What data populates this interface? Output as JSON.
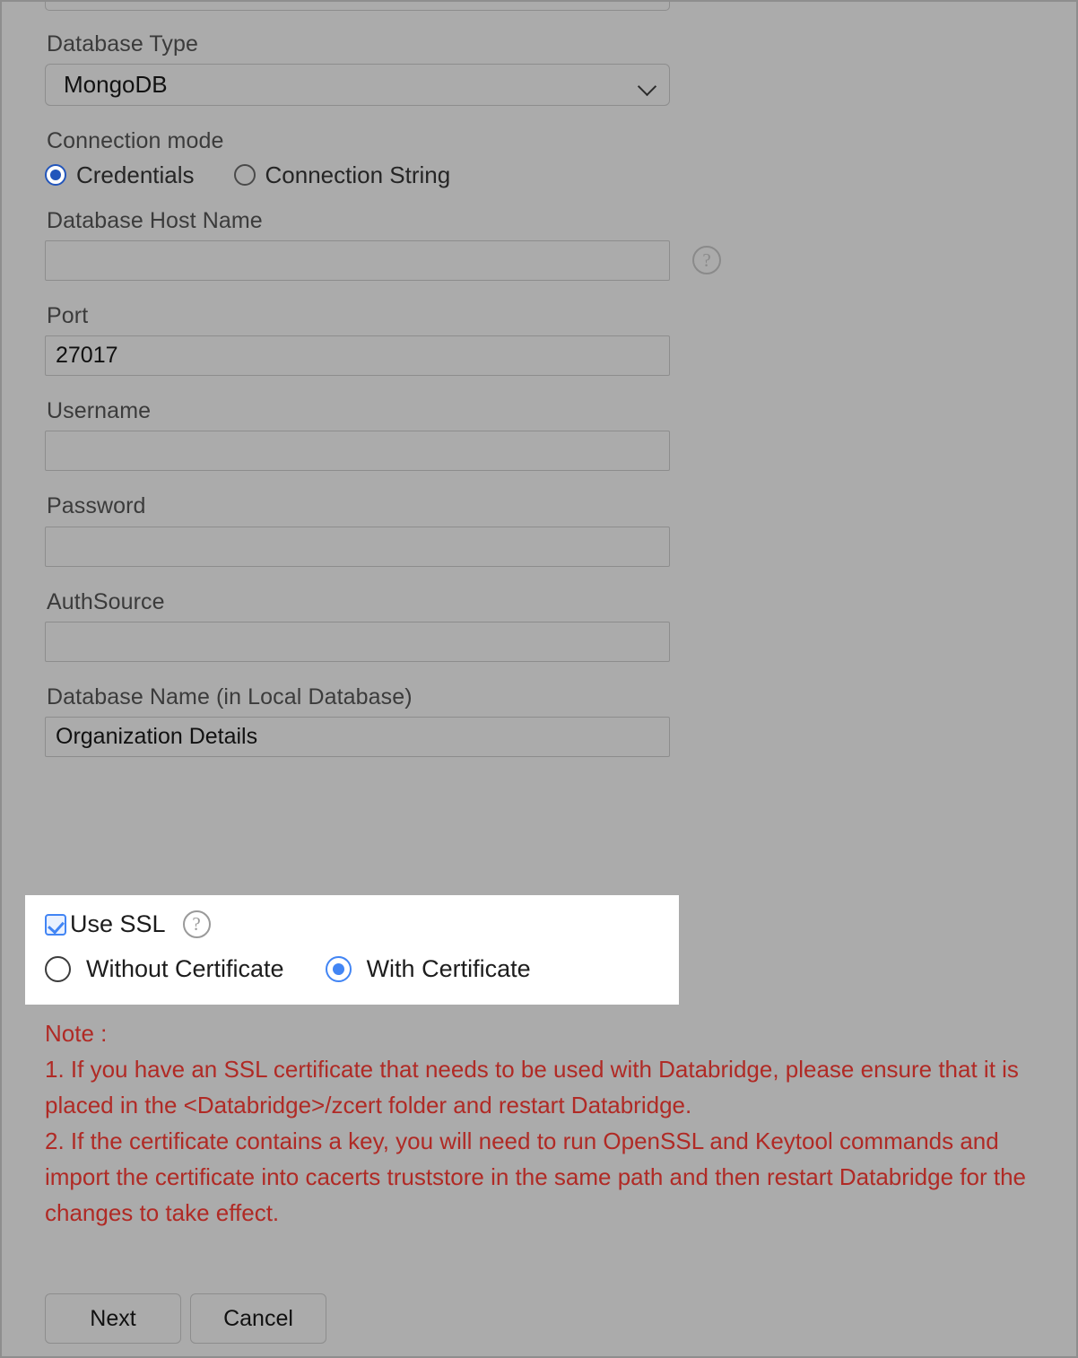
{
  "form": {
    "database_type": {
      "label": "Database Type",
      "value": "MongoDB",
      "chevron_icon": "chevron-down-icon"
    },
    "connection_mode": {
      "label": "Connection mode",
      "options": [
        {
          "label": "Credentials",
          "selected": true
        },
        {
          "label": "Connection String",
          "selected": false
        }
      ]
    },
    "database_host_name": {
      "label": "Database Host Name",
      "value": "",
      "placeholder": "",
      "help_icon": "help-icon"
    },
    "port": {
      "label": "Port",
      "value": "27017",
      "placeholder": ""
    },
    "username": {
      "label": "Username",
      "value": "",
      "placeholder": ""
    },
    "password": {
      "label": "Password",
      "value": "",
      "placeholder": ""
    },
    "authsource": {
      "label": "AuthSource",
      "value": "",
      "placeholder": ""
    },
    "database_name": {
      "label": "Database Name (in Local Database)",
      "value": "Organization Details",
      "placeholder": ""
    }
  },
  "ssl": {
    "checkbox_label": "Use SSL",
    "checked": true,
    "help_icon": "help-icon",
    "options": [
      {
        "label": "Without Certificate",
        "selected": false
      },
      {
        "label": "With Certificate",
        "selected": true
      }
    ]
  },
  "note": {
    "heading": "Note :",
    "item1": "1. If you have an SSL certificate that needs to be used with Databridge, please ensure that it is placed in the <Databridge>/zcert folder and restart Databridge.",
    "item2": "2. If the certificate contains a key, you will need to run OpenSSL and Keytool commands and import the certificate into cacerts truststore in the same path and then restart Databridge for the changes to take effect."
  },
  "buttons": {
    "next": "Next",
    "cancel": "Cancel"
  },
  "colors": {
    "background": "#ababab",
    "note_red": "#b02a25",
    "accent_blue": "#4285f4",
    "radio_blue": "#2255bb",
    "highlight_panel": "#ffffff"
  }
}
